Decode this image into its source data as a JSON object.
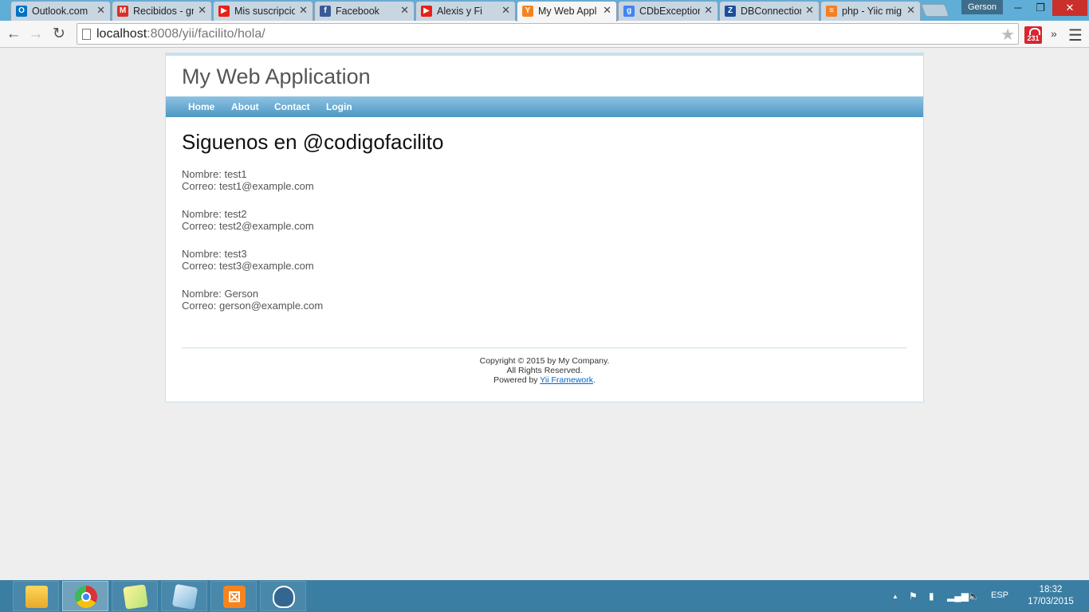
{
  "browser": {
    "tabs": [
      {
        "title": "Outlook.com",
        "icon": "outlook-icon",
        "icon_color": "#0072c6",
        "glyph": "O"
      },
      {
        "title": "Recibidos - gm",
        "icon": "gmail-icon",
        "icon_color": "#d93025",
        "glyph": "M"
      },
      {
        "title": "Mis suscripcio",
        "icon": "youtube-icon",
        "icon_color": "#e62117",
        "glyph": "▶"
      },
      {
        "title": "Facebook",
        "icon": "facebook-icon",
        "icon_color": "#3b5998",
        "glyph": "f"
      },
      {
        "title": "Alexis y Fi",
        "icon": "youtube-icon",
        "icon_color": "#e62117",
        "glyph": "▶"
      },
      {
        "title": "My Web Appl",
        "icon": "yii-icon",
        "icon_color": "#f7831e",
        "glyph": "Y"
      },
      {
        "title": "CDbException",
        "icon": "google-icon",
        "icon_color": "#4285f4",
        "glyph": "g"
      },
      {
        "title": "DBConnection",
        "icon": "zend-icon",
        "icon_color": "#1a4e9c",
        "glyph": "Z"
      },
      {
        "title": "php - Yiic mig",
        "icon": "stackoverflow-icon",
        "icon_color": "#f48024",
        "glyph": "≡"
      }
    ],
    "active_tab_index": 5,
    "profile_name": "Gerson",
    "url_host": "localhost",
    "url_rest": ":8008/yii/facilito/hola/",
    "extension_badge": "231"
  },
  "site": {
    "logo": "My Web Application",
    "menu": [
      "Home",
      "About",
      "Contact",
      "Login"
    ],
    "heading": "Siguenos en @codigofacilito",
    "users": [
      {
        "nombre": "Nombre: test1",
        "correo": "Correo: test1@example.com"
      },
      {
        "nombre": "Nombre: test2",
        "correo": "Correo: test2@example.com"
      },
      {
        "nombre": "Nombre: test3",
        "correo": "Correo: test3@example.com"
      },
      {
        "nombre": "Nombre: Gerson",
        "correo": "Correo: gerson@example.com"
      }
    ],
    "footer": {
      "copyright": "Copyright © 2015 by My Company.",
      "rights": "All Rights Reserved.",
      "powered_prefix": "Powered by ",
      "powered_link": "Yii Framework",
      "powered_suffix": "."
    }
  },
  "taskbar": {
    "apps": [
      {
        "name": "file-explorer",
        "icon": "folder-icon"
      },
      {
        "name": "chrome",
        "icon": "chrome-icon",
        "active": true
      },
      {
        "name": "sticky-notes",
        "icon": "sticky-notes-icon"
      },
      {
        "name": "notepad",
        "icon": "notepad-icon"
      },
      {
        "name": "xampp",
        "icon": "xampp-icon"
      },
      {
        "name": "postgresql",
        "icon": "postgresql-icon"
      }
    ],
    "language": "ESP",
    "time": "18:32",
    "date": "17/03/2015"
  }
}
